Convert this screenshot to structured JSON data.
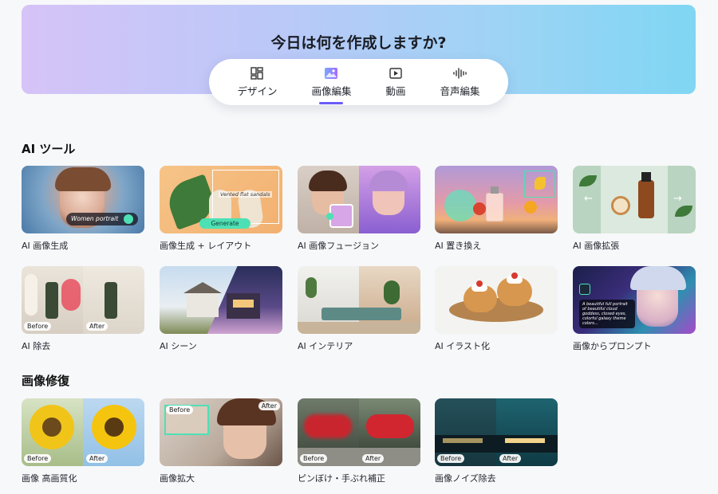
{
  "hero": {
    "title": "今日は何を作成しますか?",
    "tabs": [
      {
        "label": "デザイン",
        "icon": "design-grid-icon"
      },
      {
        "label": "画像編集",
        "icon": "image-edit-icon",
        "active": true
      },
      {
        "label": "動画",
        "icon": "video-play-icon"
      },
      {
        "label": "音声編集",
        "icon": "audio-wave-icon"
      }
    ]
  },
  "ai_tools": {
    "title": "AI ツール",
    "cards": [
      {
        "label": "AI 画像生成",
        "overlay": "Women portrait"
      },
      {
        "label": "画像生成 + レイアウト",
        "overlay_top": "Vented flat sandals",
        "overlay_button": "Generate"
      },
      {
        "label": "AI 画像フュージョン"
      },
      {
        "label": "AI 置き換え"
      },
      {
        "label": "AI 画像拡張"
      },
      {
        "label": "AI 除去",
        "before": "Before",
        "after": "After"
      },
      {
        "label": "AI シーン"
      },
      {
        "label": "AI インテリア"
      },
      {
        "label": "AI イラスト化"
      },
      {
        "label": "画像からプロンプト",
        "overlay": "A beautiful full portrait of beautiful cloud goddess, closed eyes, colorful galaxy theme colors..."
      }
    ]
  },
  "restore": {
    "title": "画像修復",
    "cards": [
      {
        "label": "画像 高画質化",
        "before": "Before",
        "after": "After"
      },
      {
        "label": "画像拡大",
        "before": "Before",
        "after": "After"
      },
      {
        "label": "ピンぼけ・手ぶれ補正",
        "before": "Before",
        "after": "After"
      },
      {
        "label": "画像ノイズ除去",
        "before": "Before",
        "after": "After"
      }
    ]
  },
  "colors": {
    "accent": "#6b5cf6",
    "generate_button": "#4ee0b5"
  }
}
